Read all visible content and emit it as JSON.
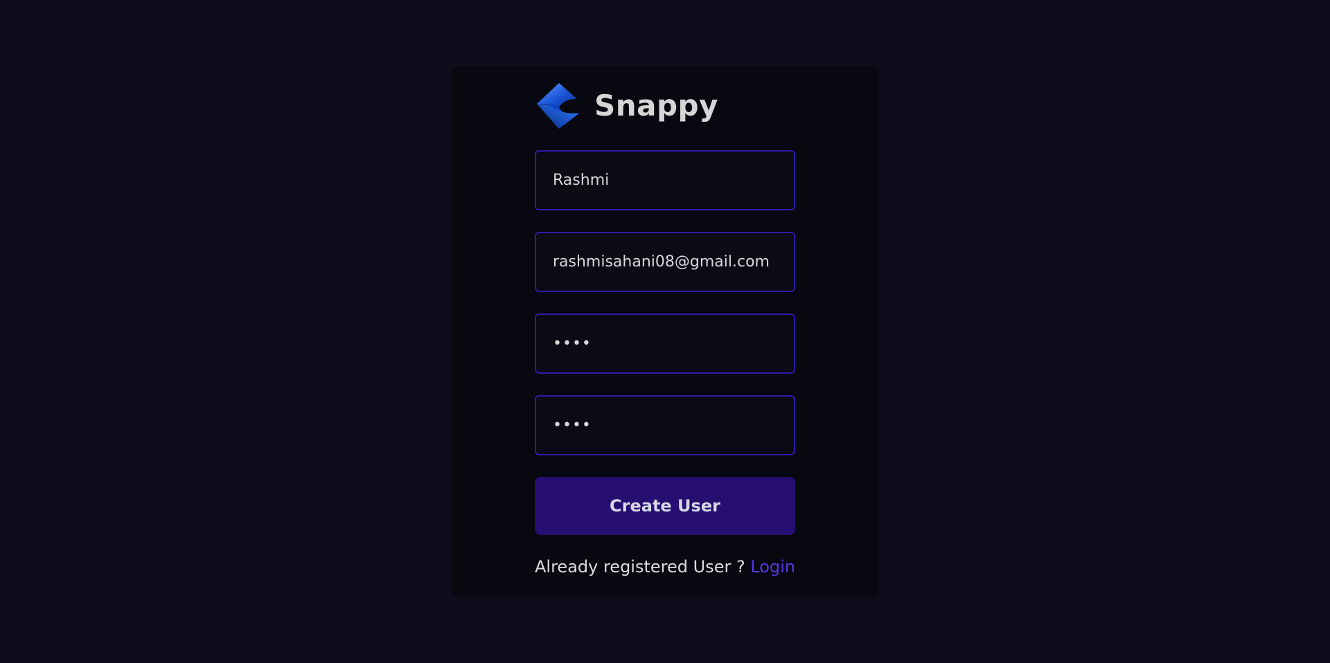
{
  "brand": {
    "name": "Snappy",
    "logo_icon": "snappy-logo-icon"
  },
  "form": {
    "username": {
      "value": "Rashmi"
    },
    "email": {
      "value": "rashmisahani08@gmail.com"
    },
    "password": {
      "value": "••••"
    },
    "confirm_password": {
      "value": "••••"
    },
    "submit_label": "Create User"
  },
  "footer": {
    "prompt": "Already registered User ? ",
    "login_label": "Login"
  },
  "colors": {
    "background": "#0d0d1b",
    "card": "#080810",
    "accent": "#2f1aa6",
    "button": "#260f71",
    "link": "#5b34e6"
  }
}
